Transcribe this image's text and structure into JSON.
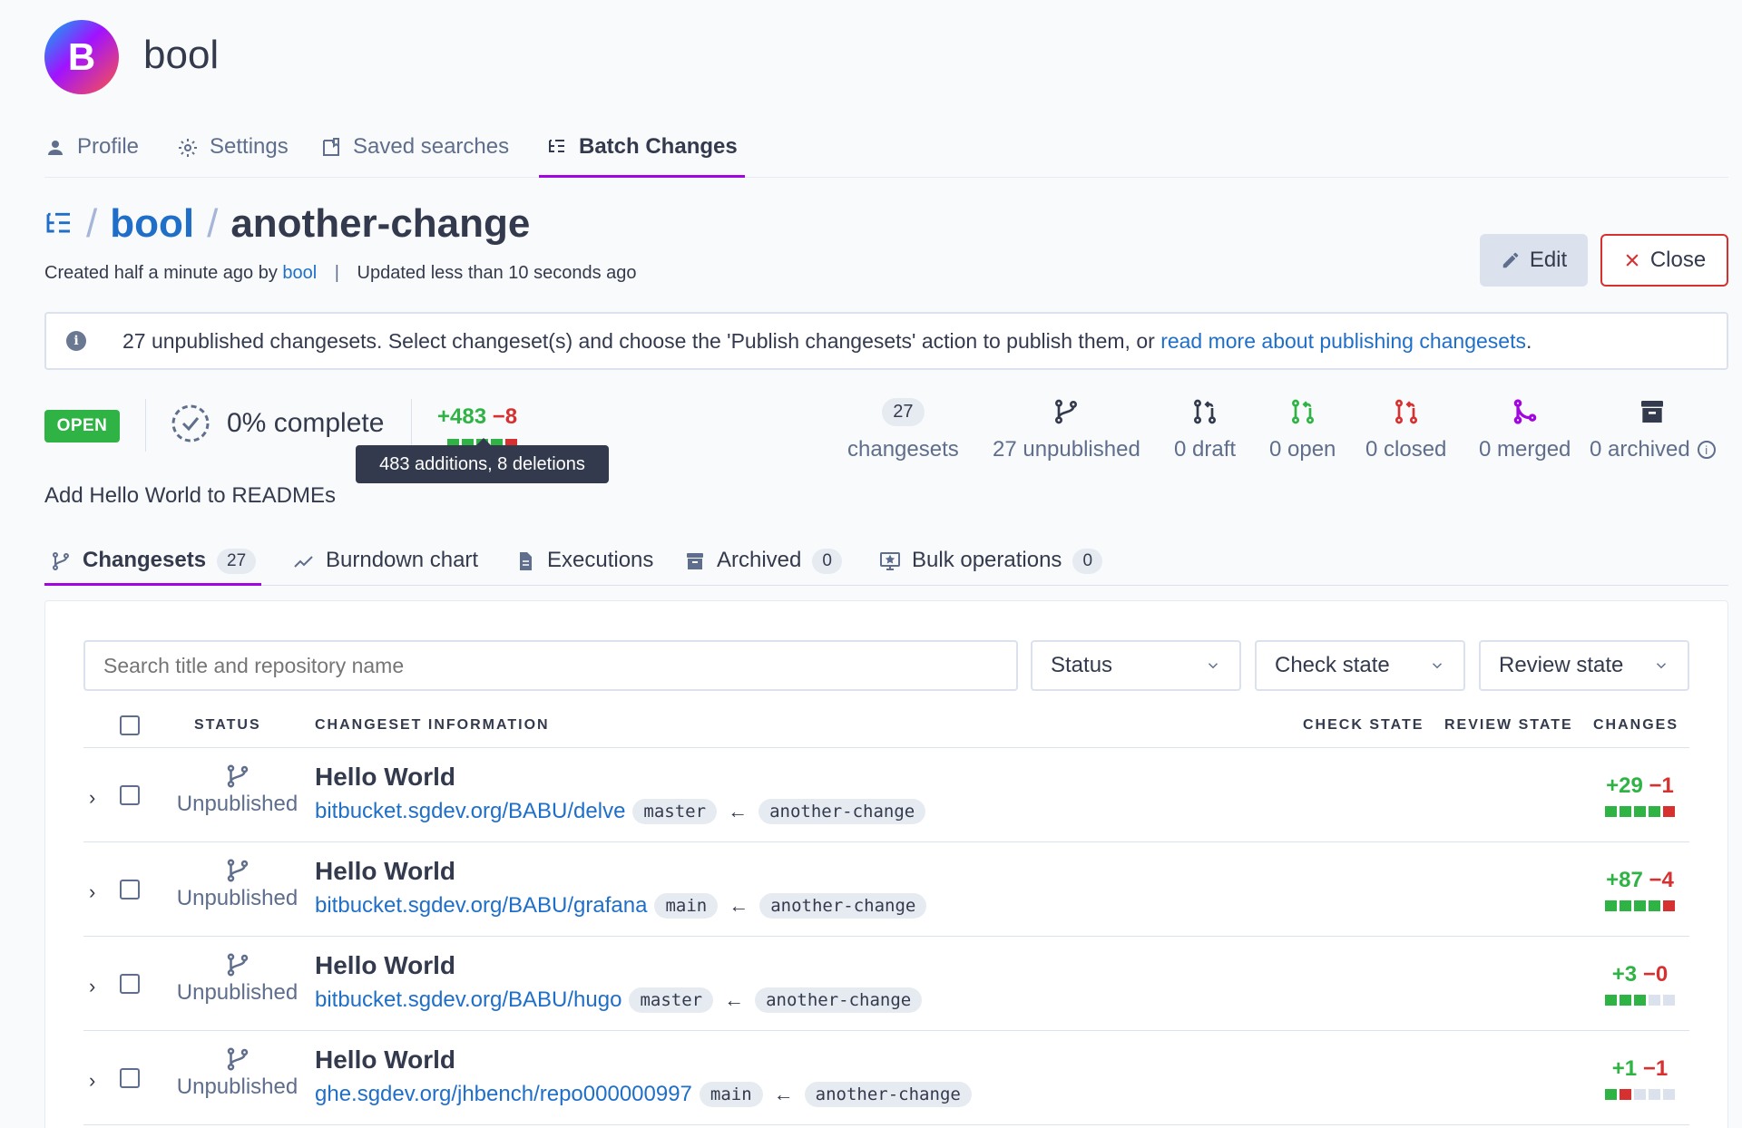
{
  "user": {
    "initial": "B",
    "name": "bool"
  },
  "nav": {
    "profile": "Profile",
    "settings": "Settings",
    "saved": "Saved searches",
    "batch": "Batch Changes"
  },
  "title": {
    "sep1": "/",
    "namespace": "bool",
    "sep2": "/",
    "name": "another-change"
  },
  "meta": {
    "created": "Created half a minute ago by",
    "author": "bool",
    "separator": "|",
    "updated": "Updated less than 10 seconds ago"
  },
  "buttons": {
    "edit": "Edit",
    "close": "Close"
  },
  "alert": {
    "icon": "i",
    "text": "27 unpublished changesets. Select changeset(s) and choose the 'Publish changesets' action to publish them, or ",
    "link": "read more about publishing changesets",
    "suffix": "."
  },
  "status_badge": "OPEN",
  "progress": {
    "percent": 0,
    "label": "0% complete"
  },
  "diff": {
    "added": "+483",
    "deleted": "−8",
    "tooltip": "483 additions, 8 deletions"
  },
  "stats": {
    "changesets_count": "27",
    "changesets_label": "changesets",
    "unpublished": "27 unpublished",
    "draft": "0 draft",
    "open": "0 open",
    "closed": "0 closed",
    "merged": "0 merged",
    "archived": "0 archived",
    "info_icon": "i"
  },
  "description": "Add Hello World to READMEs",
  "subtabs": {
    "changesets": "Changesets",
    "changesets_count": "27",
    "burndown": "Burndown chart",
    "executions": "Executions",
    "archived": "Archived",
    "archived_count": "0",
    "bulk": "Bulk operations",
    "bulk_count": "0"
  },
  "filters": {
    "search_placeholder": "Search title and repository name",
    "status": "Status",
    "check": "Check state",
    "review": "Review state"
  },
  "table": {
    "headers": {
      "status": "STATUS",
      "info": "CHANGESET INFORMATION",
      "check": "CHECK STATE",
      "review": "REVIEW STATE",
      "changes": "CHANGES"
    },
    "rows": [
      {
        "status": "Unpublished",
        "title": "Hello World",
        "repo": "bitbucket.sgdev.org/BABU/delve",
        "base": "master",
        "head": "another-change",
        "added": "+29",
        "deleted": "−1",
        "blocks": [
          "g",
          "g",
          "g",
          "g",
          "r"
        ]
      },
      {
        "status": "Unpublished",
        "title": "Hello World",
        "repo": "bitbucket.sgdev.org/BABU/grafana",
        "base": "main",
        "head": "another-change",
        "added": "+87",
        "deleted": "−4",
        "blocks": [
          "g",
          "g",
          "g",
          "g",
          "r"
        ]
      },
      {
        "status": "Unpublished",
        "title": "Hello World",
        "repo": "bitbucket.sgdev.org/BABU/hugo",
        "base": "master",
        "head": "another-change",
        "added": "+3",
        "deleted": "−0",
        "blocks": [
          "g",
          "g",
          "g",
          "n",
          "n"
        ]
      },
      {
        "status": "Unpublished",
        "title": "Hello World",
        "repo": "ghe.sgdev.org/jhbench/repo000000997",
        "base": "main",
        "head": "another-change",
        "added": "+1",
        "deleted": "−1",
        "blocks": [
          "g",
          "r",
          "n",
          "n",
          "n"
        ]
      }
    ],
    "arrow": "←",
    "expand_icon": "›"
  },
  "colors": {
    "accent": "#a305e1",
    "link": "#1f6fc9",
    "added": "#2fb344",
    "deleted": "#d63030",
    "merged": "#a305e1"
  },
  "icons": {
    "avatar": "user-avatar",
    "profile": "user-icon",
    "settings": "gear-icon",
    "saved": "bookmark-icon",
    "batch": "batch-changes-icon"
  }
}
